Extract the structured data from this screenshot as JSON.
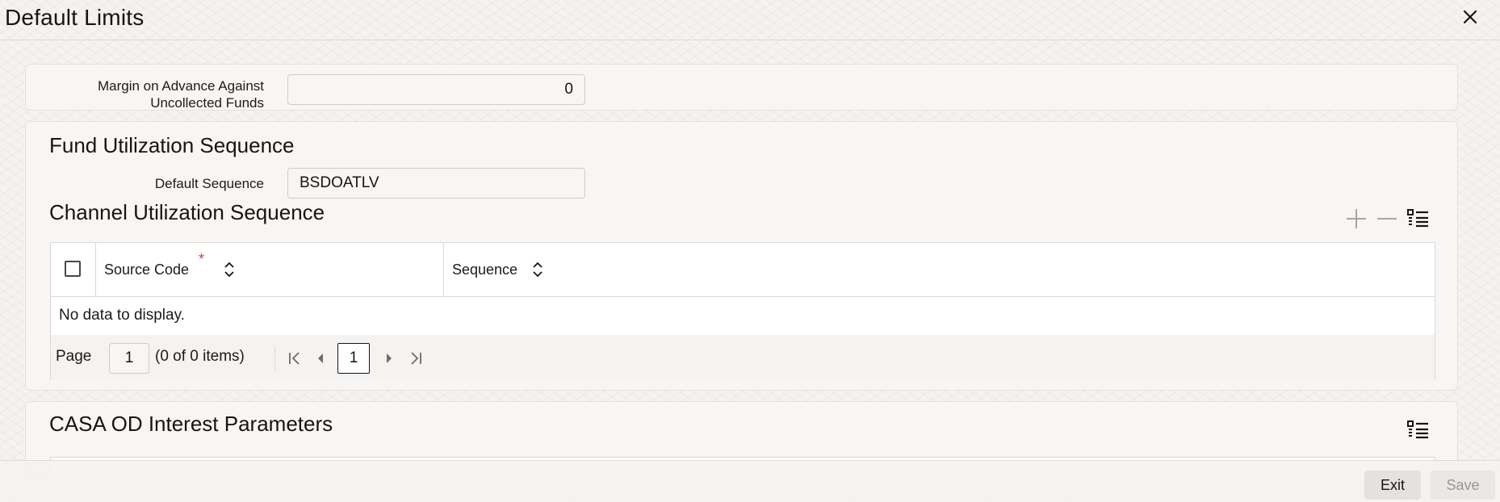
{
  "window": {
    "title": "Default Limits",
    "close_icon": "close-icon"
  },
  "margin": {
    "label": "Margin on Advance Against Uncollected Funds",
    "value": "0"
  },
  "fund_utilization": {
    "title": "Fund Utilization Sequence",
    "default_sequence_label": "Default Sequence",
    "default_sequence_value": "BSDOATLV"
  },
  "channel_utilization": {
    "title": "Channel Utilization Sequence",
    "toolbar": {
      "add_icon": "plus-icon",
      "remove_icon": "minus-icon",
      "columns_icon": "list-view-icon"
    },
    "columns": [
      {
        "label": "Source Code",
        "required": "*"
      },
      {
        "label": "Sequence"
      }
    ],
    "empty_text": "No data to display.",
    "pager": {
      "page_label": "Page",
      "page_value": "1",
      "items_text": "(0 of 0 items)",
      "current_page": "1"
    }
  },
  "casa_od": {
    "title": "CASA OD Interest Parameters",
    "columns_icon": "list-view-icon"
  },
  "footer": {
    "exit_label": "Exit",
    "save_label": "Save"
  },
  "colors": {
    "required": "#c74634",
    "text": "#161513",
    "background": "#f4f3f1"
  }
}
